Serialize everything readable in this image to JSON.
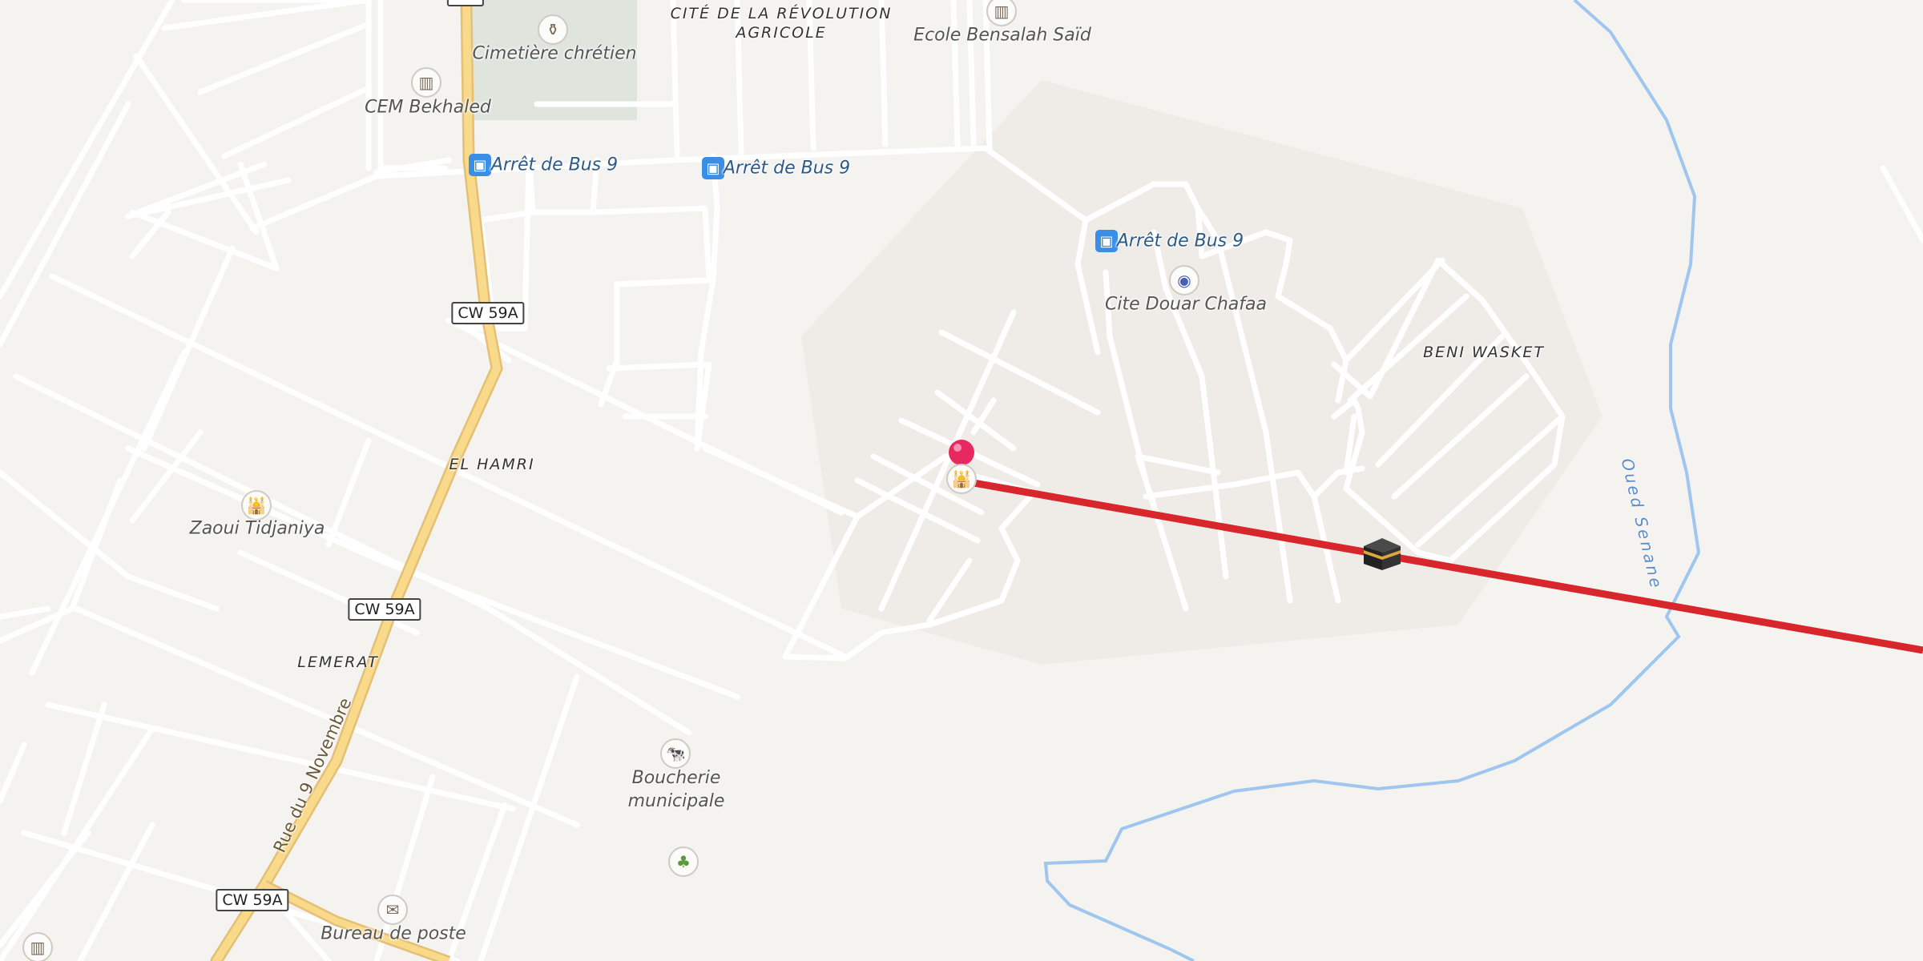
{
  "map": {
    "places": {
      "cimetiere": "Cimetière chrétien",
      "cem": "CEM Bekhaled",
      "ecole": "Ecole Bensalah Saïd",
      "cite_revolution": "CITÉ DE LA RÉVOLUTION AGRICOLE",
      "cite_douar": "Cite Douar Chafaa",
      "beni_wasket": "BENI WASKET",
      "el_hamri": "EL HAMRI",
      "zaoui": "Zaoui Tidjaniya",
      "lemerat": "LEMERAT",
      "boucherie": "Boucherie municipale",
      "poste": "Bureau de poste"
    },
    "bus_stops": [
      "Arrêt de Bus 9",
      "Arrêt de Bus 9",
      "Arrêt de Bus 9"
    ],
    "road_shields": [
      "CW 59A",
      "CW 59A",
      "CW 59A"
    ],
    "road_name": "Rue du 9 Novembre",
    "river_name": "Oued Senane",
    "colors": {
      "background": "#f5f3f0",
      "road": "#ffffff",
      "main_road": "#f9d98a",
      "water": "#9fc6ee",
      "cemetery": "#dfe4dd",
      "qibla_line": "#d7262c",
      "pin": "#e8295f"
    },
    "icons": {
      "marker": "pin-marker-icon",
      "qibla": "kaaba-icon",
      "bus": "bus-icon",
      "school": "school-icon",
      "cemetery": "cemetery-icon",
      "mosque": "mosque-icon",
      "camera": "camera-icon",
      "butcher": "cow-icon",
      "mail": "mail-icon",
      "garden": "plant-icon"
    }
  }
}
